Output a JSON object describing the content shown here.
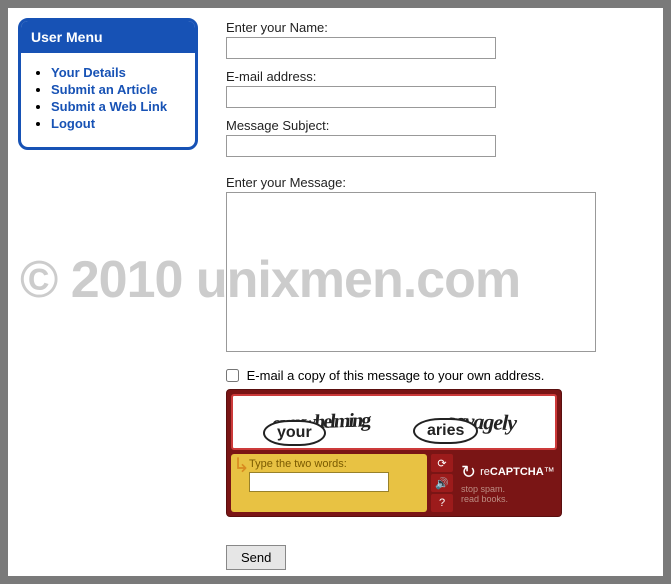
{
  "sidebar": {
    "title": "User Menu",
    "items": [
      {
        "label": "Your Details"
      },
      {
        "label": "Submit an Article"
      },
      {
        "label": "Submit a Web Link"
      },
      {
        "label": "Logout"
      }
    ]
  },
  "form": {
    "name_label": "Enter your Name:",
    "email_label": "E-mail address:",
    "subject_label": "Message Subject:",
    "message_label": "Enter your Message:",
    "name_value": "",
    "email_value": "",
    "subject_value": "",
    "message_value": "",
    "copy_label": "E-mail a copy of this message to your own address.",
    "send_label": "Send"
  },
  "captcha": {
    "word1": "overwhelming",
    "word2": "savagely",
    "bubble1": "your",
    "bubble2": "aries",
    "instruction": "Type the two words:",
    "input_value": "",
    "brand_prefix": "re",
    "brand_main": "CAPTCHA",
    "tm": "™",
    "tagline1": "stop spam.",
    "tagline2": "read books."
  },
  "watermark": "© 2010 unixmen.com"
}
